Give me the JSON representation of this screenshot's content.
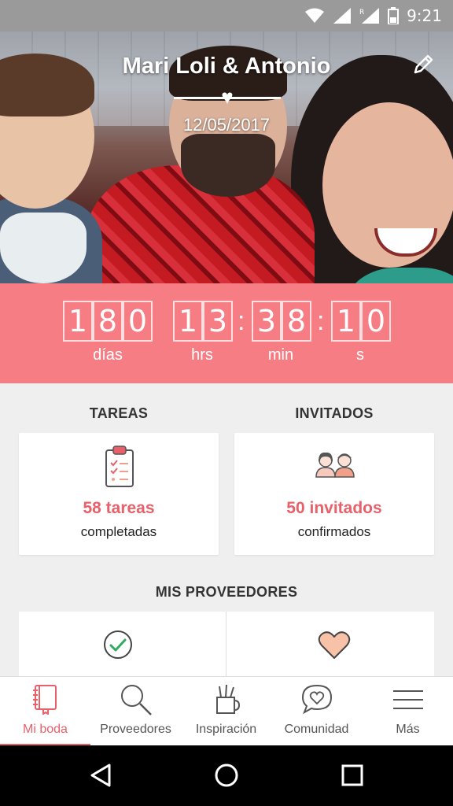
{
  "status_bar": {
    "time": "9:21",
    "icons": [
      "wifi-icon",
      "signal-icon",
      "roaming-signal-icon",
      "battery-icon"
    ]
  },
  "hero": {
    "couple_names": "Mari Loli & Antonio",
    "wedding_date": "12/05/2017",
    "edit_icon": "pencil-icon"
  },
  "countdown": {
    "days": [
      "1",
      "8",
      "0"
    ],
    "hours": [
      "1",
      "3"
    ],
    "minutes": [
      "3",
      "8"
    ],
    "seconds": [
      "1",
      "0"
    ],
    "labels": {
      "days": "días",
      "hours": "hrs",
      "minutes": "min",
      "seconds": "s"
    }
  },
  "sections": {
    "tasks": {
      "title": "TAREAS",
      "count": "58 tareas",
      "sub": "completadas",
      "icon": "clipboard-checklist-icon"
    },
    "guests": {
      "title": "INVITADOS",
      "count": "50 invitados",
      "sub": "confirmados",
      "icon": "guests-couple-icon"
    },
    "vendors": {
      "title": "MIS PROVEEDORES",
      "icons": [
        "check-circle-icon",
        "heart-icon"
      ]
    }
  },
  "bottom_nav": {
    "items": [
      {
        "label": "Mi boda",
        "icon": "notebook-icon",
        "active": true
      },
      {
        "label": "Proveedores",
        "icon": "search-icon",
        "active": false
      },
      {
        "label": "Inspiración",
        "icon": "brushes-cup-icon",
        "active": false
      },
      {
        "label": "Comunidad",
        "icon": "heart-chat-bubble-icon",
        "active": false
      },
      {
        "label": "Más",
        "icon": "hamburger-menu-icon",
        "active": false
      }
    ]
  },
  "colors": {
    "accent": "#f77d85",
    "accent_text": "#e8606a",
    "status_bar": "#9a9a9a",
    "background": "#efefef"
  }
}
